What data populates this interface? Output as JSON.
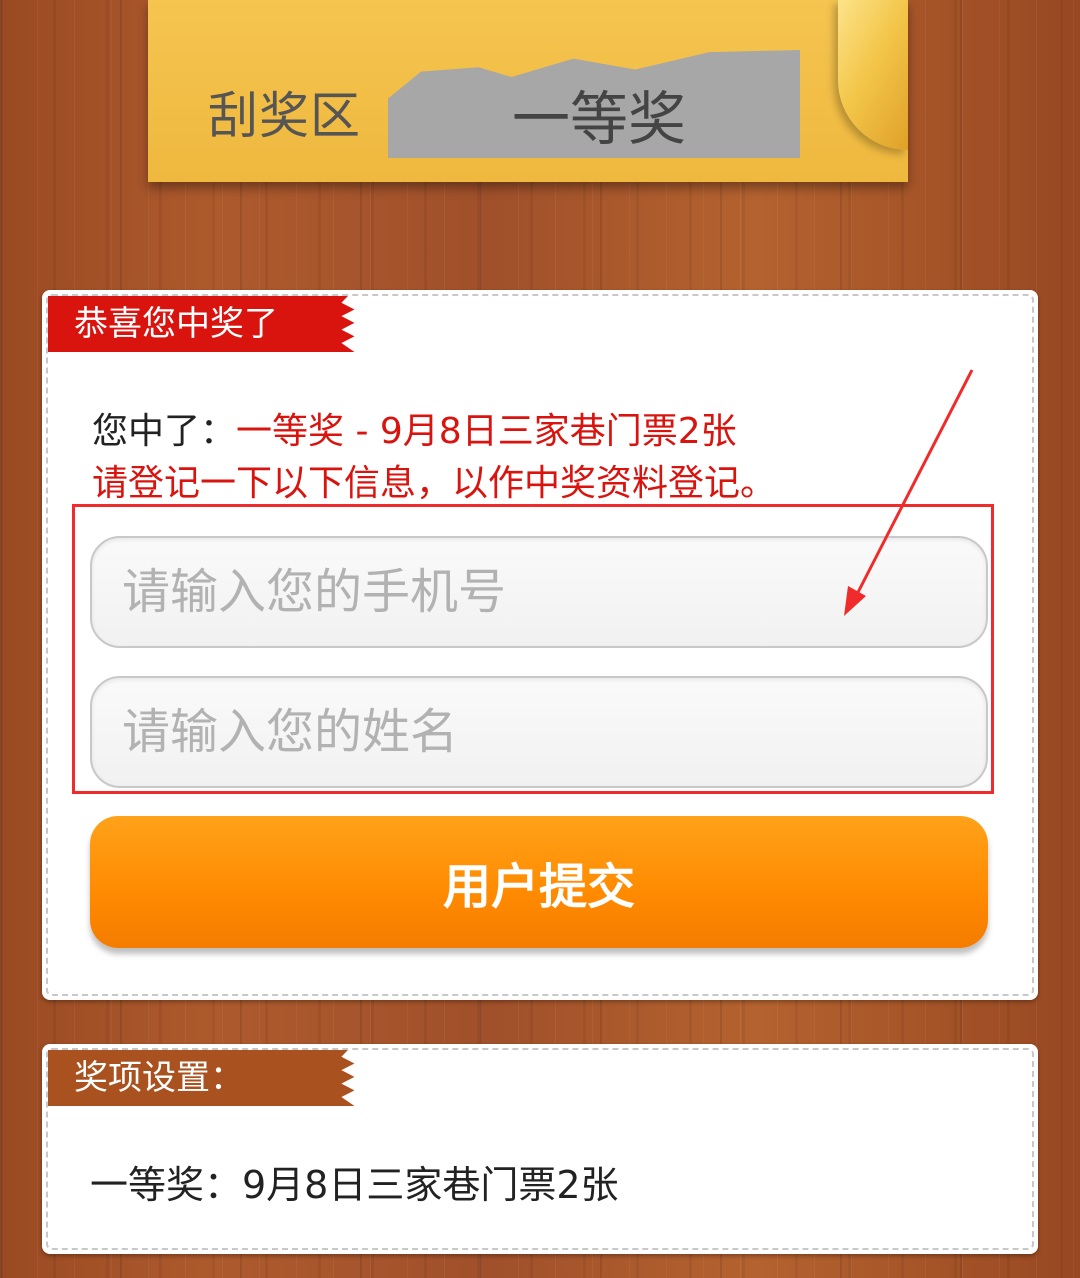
{
  "scratch": {
    "label": "刮奖区",
    "result": "一等奖"
  },
  "win_panel": {
    "ribbon_title": "恭喜您中奖了",
    "win_prefix": "您中了：",
    "win_prize": "一等奖 - 9月8日三家巷门票2张",
    "notice": "请登记一下以下信息，以作中奖资料登记。",
    "phone_placeholder": "请输入您的手机号",
    "name_placeholder": "请输入您的姓名",
    "submit_label": "用户提交"
  },
  "prize_panel": {
    "ribbon_title": "奖项设置：",
    "items": [
      "一等奖：9月8日三家巷门票2张"
    ]
  },
  "colors": {
    "accent_red": "#d9140f",
    "ribbon_brown": "#a9521f",
    "button_orange": "#ff8a00",
    "card_yellow": "#f5c550",
    "annotation_red": "#ef2b2b"
  }
}
